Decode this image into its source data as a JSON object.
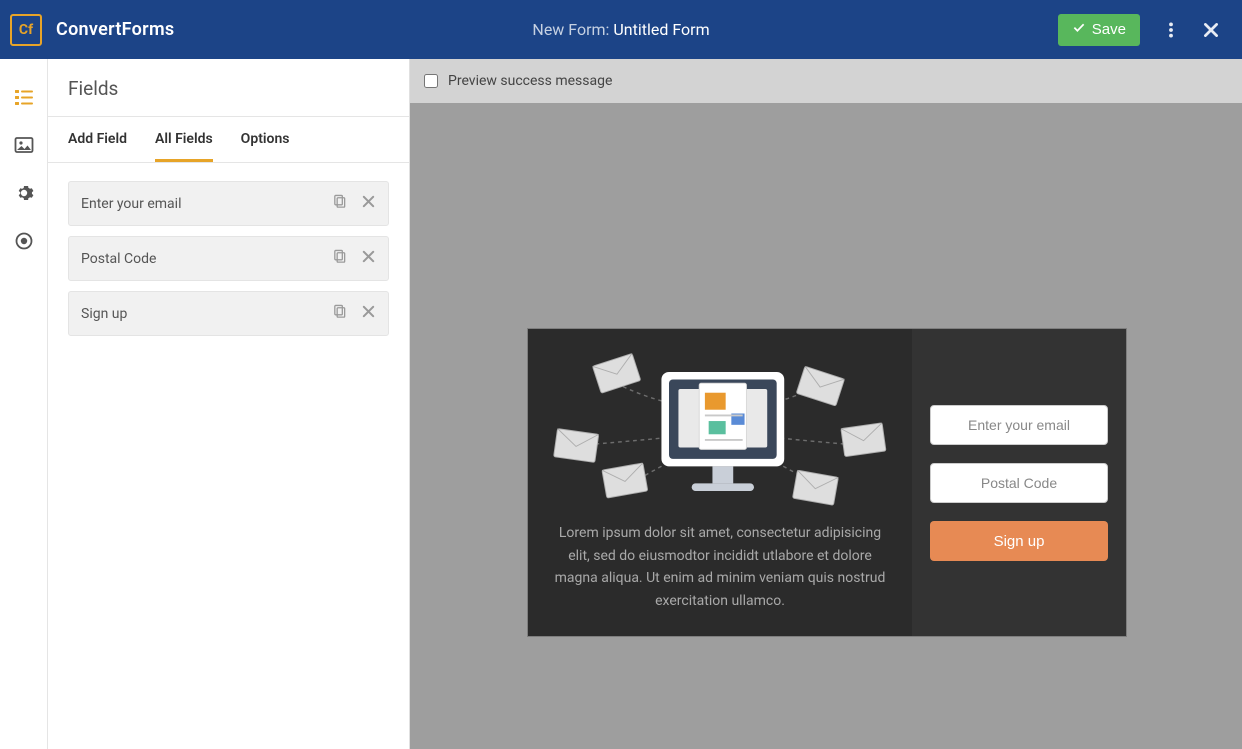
{
  "header": {
    "brand": "ConvertForms",
    "title_prefix": "New Form: ",
    "title_name": "Untitled Form",
    "save_label": "Save"
  },
  "iconrail": {
    "items": [
      {
        "name": "fields-icon"
      },
      {
        "name": "image-icon"
      },
      {
        "name": "gear-icon"
      },
      {
        "name": "target-icon"
      }
    ],
    "active_index": 0
  },
  "panel": {
    "title": "Fields",
    "tabs": [
      "Add Field",
      "All Fields",
      "Options"
    ],
    "active_tab_index": 1,
    "fields": [
      {
        "label": "Enter your email"
      },
      {
        "label": "Postal Code"
      },
      {
        "label": "Sign up"
      }
    ]
  },
  "canvas": {
    "preview_checkbox_label": "Preview success message",
    "form": {
      "description": "Lorem ipsum dolor sit amet, consectetur adipisicing elit, sed do eiusmodtor incididt utlabore et dolore magna aliqua. Ut enim ad minim veniam quis nostrud exercitation ullamco.",
      "inputs": [
        {
          "placeholder": "Enter your email"
        },
        {
          "placeholder": "Postal Code"
        }
      ],
      "submit_label": "Sign up"
    }
  }
}
